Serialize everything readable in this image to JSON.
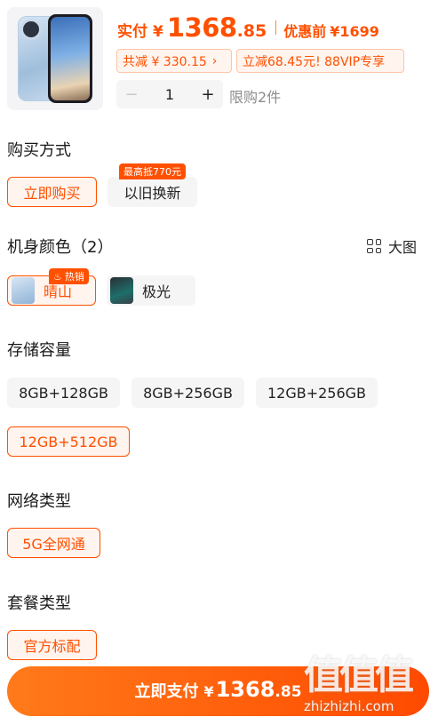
{
  "product": {
    "image_icon": "phone-product-image"
  },
  "price": {
    "label": "实付",
    "currency": "¥",
    "integer": "1368",
    "decimal": ".85",
    "original_label": "优惠前",
    "original_price": "¥1699",
    "accent_color": "#ff5000"
  },
  "promos": [
    {
      "text": "共减 ¥ 330.15",
      "chevron": "›"
    },
    {
      "text": "立减68.45元! 88VIP专享"
    }
  ],
  "quantity": {
    "minus": "−",
    "value": "1",
    "plus": "+",
    "limit": "限购2件"
  },
  "purchase_method": {
    "title": "购买方式",
    "options": [
      "立即购买",
      "以旧换新"
    ],
    "selected": "立即购买",
    "tradein_badge": "最高抵770元"
  },
  "color": {
    "title": "机身颜色（2）",
    "big_view": "大图",
    "options": [
      "晴山",
      "极光"
    ],
    "selected": "晴山",
    "hot_badge": "热销"
  },
  "storage": {
    "title": "存储容量",
    "options": [
      "8GB+128GB",
      "8GB+256GB",
      "12GB+256GB",
      "12GB+512GB"
    ],
    "selected": "12GB+512GB"
  },
  "network": {
    "title": "网络类型",
    "options": [
      "5G全网通"
    ],
    "selected": "5G全网通"
  },
  "package": {
    "title": "套餐类型",
    "options": [
      "官方标配"
    ],
    "selected": "官方标配"
  },
  "pay_button": {
    "label": "立即支付",
    "currency": "¥",
    "integer": "1368",
    "decimal": ".85"
  },
  "watermark": {
    "logo": "值值值",
    "url": "zhizhizhi.com"
  }
}
